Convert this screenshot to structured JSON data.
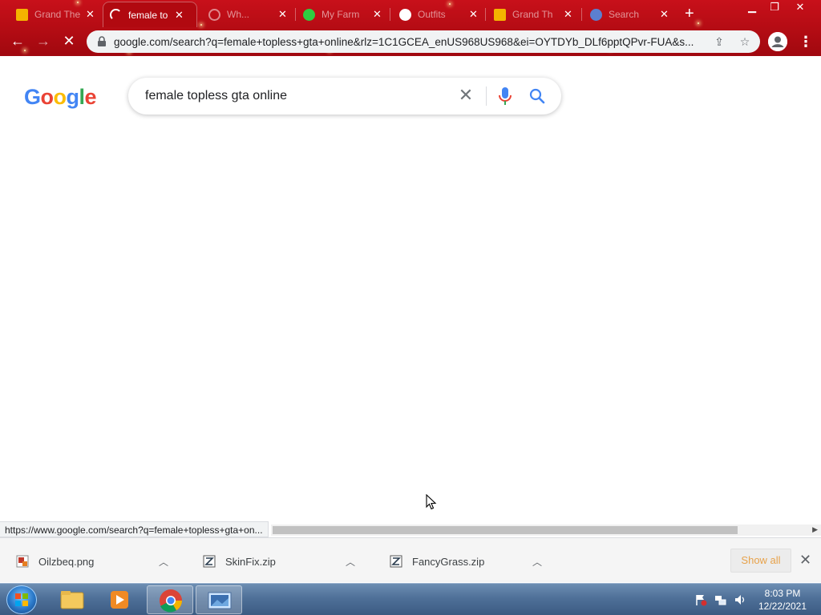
{
  "browser": {
    "tabs": [
      {
        "label": "Grand The",
        "active": false
      },
      {
        "label": "female to",
        "active": true
      },
      {
        "label": "Wh...",
        "active": false
      },
      {
        "label": "My Farm",
        "active": false
      },
      {
        "label": "Outfits",
        "active": false
      },
      {
        "label": "Grand Th",
        "active": false
      },
      {
        "label": "Search",
        "active": false
      }
    ],
    "new_tab_label": "+",
    "url": "google.com/search?q=female+topless+gta+online&rlz=1C1GCEA_enUS968US968&ei=OYTDYb_DLf6pptQPvr-FUA&s..."
  },
  "google": {
    "logo_letters": [
      {
        "ch": "G",
        "color": "#4285F4"
      },
      {
        "ch": "o",
        "color": "#EA4335"
      },
      {
        "ch": "o",
        "color": "#FBBC05"
      },
      {
        "ch": "g",
        "color": "#4285F4"
      },
      {
        "ch": "l",
        "color": "#34A853"
      },
      {
        "ch": "e",
        "color": "#EA4335"
      }
    ],
    "query": "female topless gta online"
  },
  "status_bar": {
    "hover_url": "https://www.google.com/search?q=female+topless+gta+on..."
  },
  "downloads": {
    "items": [
      {
        "name": "Oilzbeq.png"
      },
      {
        "name": "SkinFix.zip"
      },
      {
        "name": "FancyGrass.zip"
      }
    ],
    "show_all_label": "Show all"
  },
  "taskbar": {
    "time": "8:03 PM",
    "date": "12/22/2021"
  }
}
